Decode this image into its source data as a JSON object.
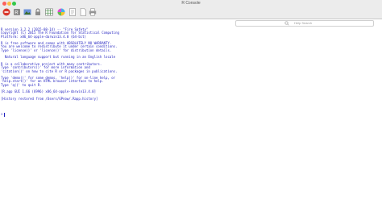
{
  "window": {
    "title": "R Console"
  },
  "toolbar": {
    "buttons": [
      {
        "name": "stop-icon"
      },
      {
        "name": "rscript-icon"
      },
      {
        "name": "image-icon"
      },
      {
        "name": "lock-icon"
      },
      {
        "name": "grid-icon"
      },
      {
        "name": "colors-icon"
      },
      {
        "name": "source-icon"
      },
      {
        "name": "new-document-icon"
      },
      {
        "name": "print-icon"
      }
    ]
  },
  "search": {
    "placeholder": "Help Search"
  },
  "console": {
    "lines": [
      "R version 3.2.2 (2015-08-14) -- \"Fire Safety\"",
      "Copyright (C) 2015 The R Foundation for Statistical Computing",
      "Platform: x86_64-apple-darwin13.4.0 (64-bit)",
      "",
      "R is free software and comes with ABSOLUTELY NO WARRANTY.",
      "You are welcome to redistribute it under certain conditions.",
      "Type 'license()' or 'licence()' for distribution details.",
      "",
      "  Natural language support but running in an English locale",
      "",
      "R is a collaborative project with many contributors.",
      "Type 'contributors()' for more information and",
      "'citation()' on how to cite R or R packages in publications.",
      "",
      "Type 'demo()' for some demos, 'help()' for on-line help, or",
      "'help.start()' for an HTML browser interface to help.",
      "Type 'q()' to quit R.",
      "",
      "[R.app GUI 1.66 (6996) x86_64-apple-darwin13.4.0]",
      "",
      "[History restored from /Users/GPnow/.Rapp.history]"
    ],
    "prompt": ">"
  }
}
